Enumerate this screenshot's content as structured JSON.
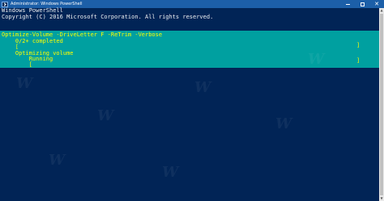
{
  "window": {
    "title": "Administrator: Windows PowerShell",
    "controls": {
      "minimize_icon": "minimize-icon",
      "maximize_icon": "maximize-icon",
      "close_glyph": "✕"
    }
  },
  "console": {
    "header_lines": [
      "Windows PowerShell",
      "Copyright (C) 2016 Microsoft Corporation. All rights reserved."
    ],
    "progress": {
      "activity": "Optimize-Volume -DriveLetter F -ReTrim -Verbose",
      "status": "0/2+ completed",
      "bar_open": "[",
      "bar_close": "]",
      "sub_activity": "Optimizing volume",
      "sub_status": "Running",
      "sub_bar_open": "[",
      "sub_bar_close": "]",
      "percent_complete": 0
    }
  },
  "colors": {
    "background": "#012456",
    "titlebar": "#1c5fa8",
    "progress_panel": "#00a0a0",
    "progress_text": "#ffff00",
    "console_text": "#eeedf0"
  }
}
